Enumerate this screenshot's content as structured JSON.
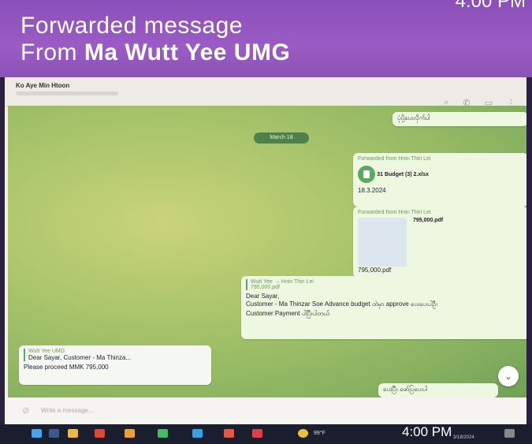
{
  "header": {
    "line1": "Forwarded message",
    "from_prefix": "From",
    "sender": "Ma Wutt Yee UMG",
    "time_top": "4:00 PM"
  },
  "chat": {
    "contact_name": "Ko Aye Min Htoon",
    "date_pill": "March 18",
    "input_placeholder": "Write a message..."
  },
  "messages": {
    "m0_text": "ပုံပို့ပေးလိုက်ပါ",
    "m1_fwd": "Forwarded from Hnin Thiri Lei",
    "m1_file": "31 Budget (3) 2.xlsx",
    "m1_caption": "18.3.2024",
    "m2_fwd": "Forwarded from Hnin Thiri Lei",
    "m2_file": "795,000.pdf",
    "m2_caption": "795,000.pdf",
    "m3_quote_name": "Wutt Yee → Hnin Thiri Lei",
    "m3_quote_file": "795,000.pdf",
    "m3_text1": "Dear Sayar,",
    "m3_text2": "Customer - Ma Thinzar Soe Advance budget ထဲမှာ approve ပေးပေးပါဦး",
    "m3_text3": "Customer Payment ပါပြီးပါတယ်",
    "m4_quote_name": "Wutt Yee UMG",
    "m4_text1": "Dear Sayar, Customer - Ma Thinza...",
    "m4_text2": "Please proceed MMK 795,000",
    "m5_text": "ပေးပြီး ဖော်ပြပေးပါ"
  },
  "taskbar": {
    "temp": "99°F",
    "time": "4:00 PM",
    "date": "3/18/2024"
  },
  "colors": {
    "header_purple": "#9a5cc4",
    "chat_green": "#a8c46a",
    "taskbar": "#1a1e2e"
  }
}
